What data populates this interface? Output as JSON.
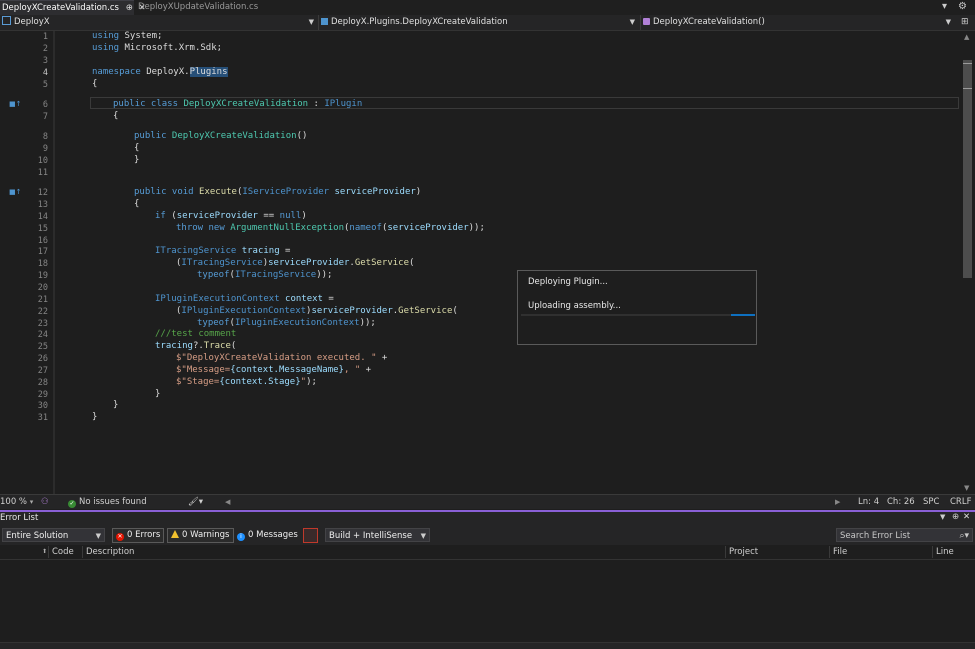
{
  "tabs": [
    {
      "label": "DeployXCreateValidation.cs",
      "active": true,
      "pin": "⊕",
      "close": "✕"
    },
    {
      "label": "DeployXUpdateValidation.cs",
      "active": false
    }
  ],
  "nav": {
    "project": "DeployX",
    "class": "DeployX.Plugins.DeployXCreateValidation",
    "member": "DeployXCreateValidation()"
  },
  "editor": {
    "current_line": 4,
    "lines": [
      {
        "n": "1"
      },
      {
        "n": "2"
      },
      {
        "n": "3"
      },
      {
        "n": "4"
      },
      {
        "n": "5"
      },
      {
        "n": "6"
      },
      {
        "n": "7"
      },
      {
        "n": "8"
      },
      {
        "n": "9"
      },
      {
        "n": "10"
      },
      {
        "n": "11"
      },
      {
        "n": "12"
      },
      {
        "n": "13"
      },
      {
        "n": "14"
      },
      {
        "n": "15"
      },
      {
        "n": "16"
      },
      {
        "n": "17"
      },
      {
        "n": "18"
      },
      {
        "n": "19"
      },
      {
        "n": "20"
      },
      {
        "n": "21"
      },
      {
        "n": "22"
      },
      {
        "n": "23"
      },
      {
        "n": "24"
      },
      {
        "n": "25"
      },
      {
        "n": "26"
      },
      {
        "n": "27"
      },
      {
        "n": "28"
      },
      {
        "n": "29"
      },
      {
        "n": "30"
      },
      {
        "n": "31"
      }
    ],
    "code": {
      "l1_kw": "using",
      "l1_rest": " System;",
      "l2_kw": "using",
      "l2_rest": " Microsoft.Xrm.Sdk;",
      "l4_kw": "namespace",
      "l4_ns": " DeployX.",
      "l4_sel": "Plugins",
      "l5": "{",
      "l6_kw": "public class",
      "l6_ty": " DeployXCreateValidation",
      "l6_colon": " : ",
      "l6_if": "IPlugin",
      "l7": "{",
      "l8_kw": "public",
      "l8_ty": " DeployXCreateValidation",
      "l8_rest": "()",
      "l9": "{",
      "l10": "}",
      "l12_kw": "public void",
      "l12_mt": " Execute",
      "l12_p1": "(",
      "l12_ty": "IServiceProvider",
      "l12_pr": " serviceProvider",
      "l12_p2": ")",
      "l13": "{",
      "l14_kw": "if",
      "l14_p1": " (",
      "l14_pr": "serviceProvider",
      "l14_op": " == ",
      "l14_null": "null",
      "l14_p2": ")",
      "l15_kw": "throw new",
      "l15_ty": " ArgumentNullException",
      "l15_p1": "(",
      "l15_nameof": "nameof",
      "l15_p2": "(",
      "l15_pr": "serviceProvider",
      "l15_p3": "));",
      "l17_ty": "ITracingService",
      "l17_pr": " tracing",
      "l17_rest": " =",
      "l18_p1": "(",
      "l18_ty": "ITracingService",
      "l18_p2": ")",
      "l18_pr": "serviceProvider",
      "l18_dot": ".",
      "l18_mt": "GetService",
      "l18_p3": "(",
      "l19_kw": "typeof",
      "l19_p1": "(",
      "l19_ty": "ITracingService",
      "l19_p2": "));",
      "l21_ty": "IPluginExecutionContext",
      "l21_pr": " context",
      "l21_rest": " =",
      "l22_p1": "(",
      "l22_ty": "IPluginExecutionContext",
      "l22_p2": ")",
      "l22_pr": "serviceProvider",
      "l22_dot": ".",
      "l22_mt": "GetService",
      "l22_p3": "(",
      "l23_kw": "typeof",
      "l23_p1": "(",
      "l23_ty": "IPluginExecutionContext",
      "l23_p2": "));",
      "l24": "///test comment",
      "l25_pr": "tracing",
      "l25_q": "?.",
      "l25_mt": "Trace",
      "l25_p": "(",
      "l26_st": "$\"DeployXCreateValidation executed. \"",
      "l26_rest": " +",
      "l27_st1": "$\"Message=",
      "l27_pr": "{context.MessageName}",
      "l27_st2": ", \"",
      "l27_rest": " +",
      "l28_st1": "$\"Stage=",
      "l28_pr": "{context.Stage}",
      "l28_st2": "\"",
      "l28_rest": ");",
      "l29": "}",
      "l30": "}",
      "l31": "}"
    }
  },
  "dialog": {
    "title": "Deploying Plugin...",
    "status": "Uploading assembly..."
  },
  "status_bar": {
    "zoom": "100 %",
    "issues": "No issues found",
    "ln": "Ln: 4",
    "ch": "Ch: 26",
    "spc": "SPC",
    "crlf": "CRLF"
  },
  "error_list": {
    "title": "Error List",
    "scope": "Entire Solution",
    "errors": "0 Errors",
    "warnings": "0 Warnings",
    "messages": "0 Messages",
    "build_filter": "Build + IntelliSense",
    "search_placeholder": "Search Error List",
    "columns": [
      "Code",
      "Description",
      "Project",
      "File",
      "Line"
    ]
  },
  "colors": {
    "accent": "#0e70c0",
    "panel_separator": "#8a60d6",
    "error": "#e51400",
    "warning": "#f2c12e",
    "ok": "#388a34"
  }
}
